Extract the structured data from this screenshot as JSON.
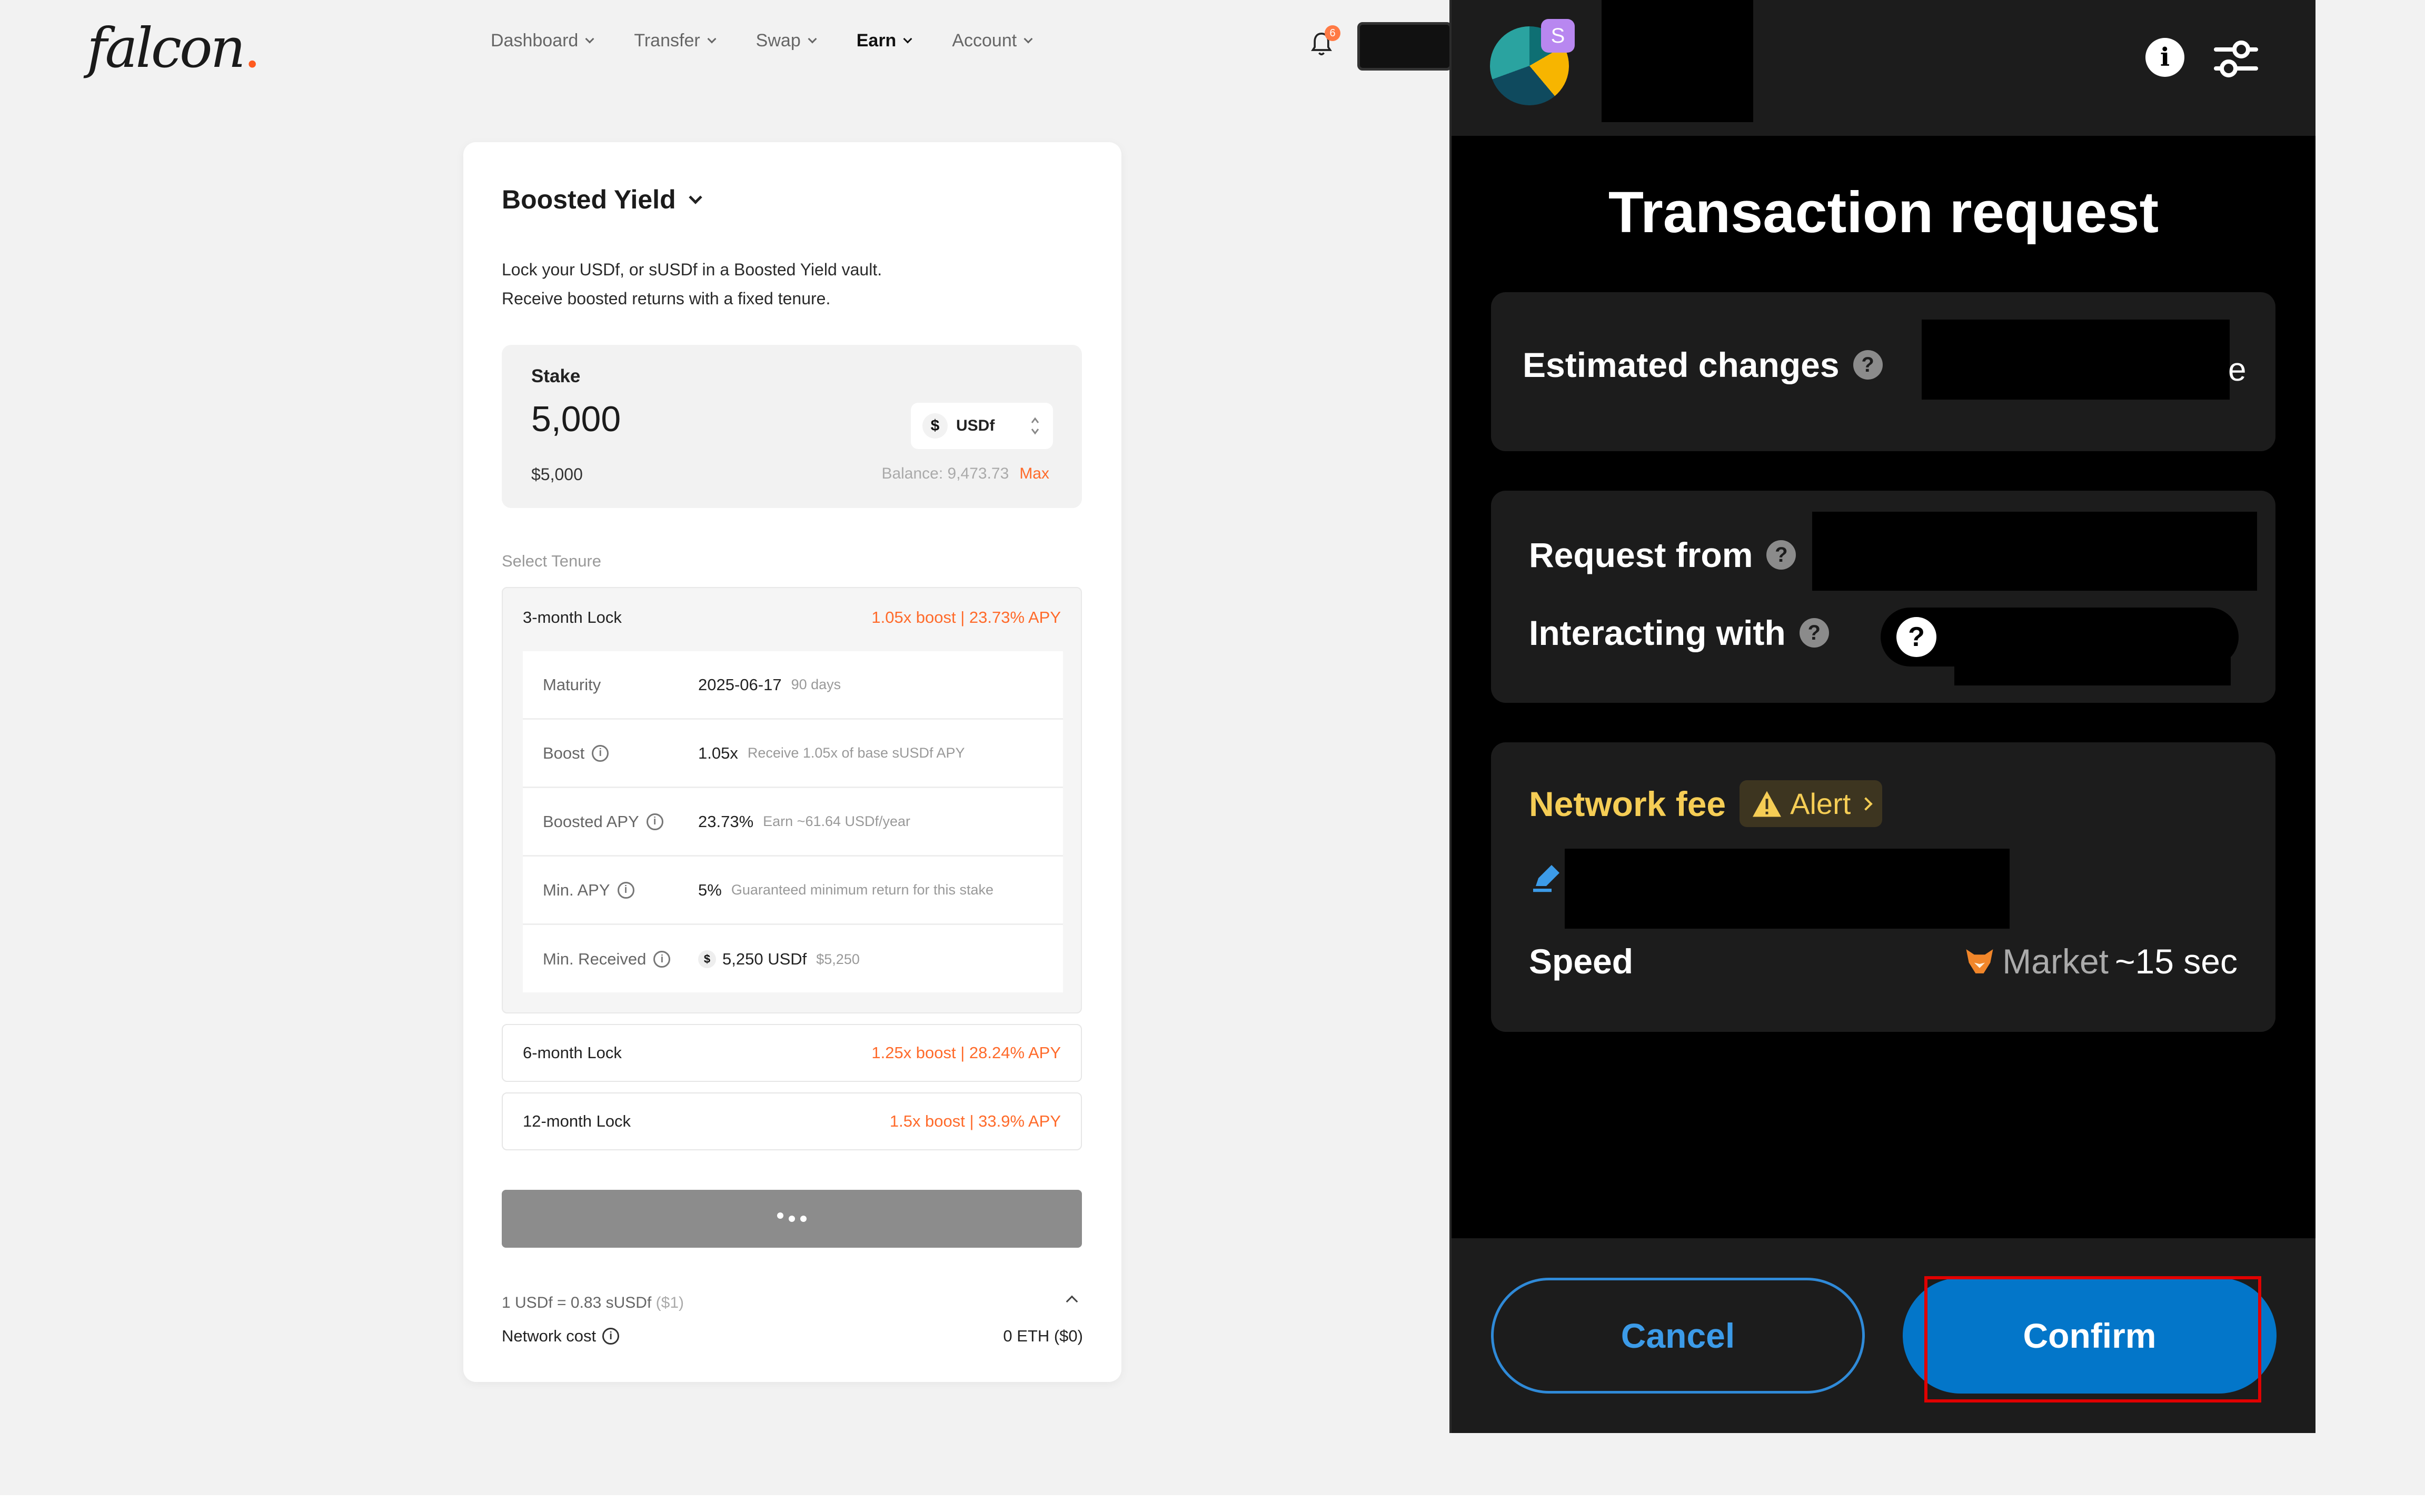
{
  "brand": {
    "name": "falcon",
    "dot": "."
  },
  "nav": {
    "items": [
      {
        "label": "Dashboard"
      },
      {
        "label": "Transfer"
      },
      {
        "label": "Swap"
      },
      {
        "label": "Earn"
      },
      {
        "label": "Account"
      }
    ],
    "active": "Earn",
    "notification_count": "6"
  },
  "stake_card": {
    "title": "Boosted Yield",
    "description_line1": "Lock your USDf, or sUSDf in a Boosted Yield vault.",
    "description_line2": "Receive boosted returns with a fixed tenure.",
    "stake_label": "Stake",
    "amount": "5,000",
    "amount_usd": "$5,000",
    "token": "USDf",
    "token_symbol": "$",
    "balance": "Balance: 9,473.73",
    "max_label": "Max",
    "select_tenure_label": "Select Tenure",
    "tenures": [
      {
        "name": "3-month Lock",
        "boost": "1.05x boost | 23.73% APY"
      },
      {
        "name": "6-month Lock",
        "boost": "1.25x boost | 28.24% APY"
      },
      {
        "name": "12-month Lock",
        "boost": "1.5x boost | 33.9% APY"
      }
    ],
    "details": {
      "maturity": {
        "label": "Maturity",
        "value": "2025-06-17",
        "note": "90 days"
      },
      "boost": {
        "label": "Boost",
        "value": "1.05x",
        "note": "Receive 1.05x of base sUSDf APY"
      },
      "boosted_apy": {
        "label": "Boosted APY",
        "value": "23.73%",
        "note": "Earn ~61.64 USDf/year"
      },
      "min_apy": {
        "label": "Min. APY",
        "value": "5%",
        "note": "Guaranteed minimum return for this stake"
      },
      "min_received": {
        "label": "Min. Received",
        "value": "5,250 USDf",
        "note": "$5,250"
      }
    },
    "rate": "1 USDf = 0.83 sUSDf",
    "rate_usd": "($1)",
    "network_cost_label": "Network cost",
    "network_cost_value": "0 ETH ($0)"
  },
  "wallet": {
    "account_badge": "S",
    "title": "Transaction request",
    "estimated_changes_label": "Estimated changes",
    "estimated_changes_tail": "e",
    "request_from_label": "Request from",
    "interacting_with_label": "Interacting with",
    "network_fee_label": "Network fee",
    "alert_label": "Alert",
    "speed_label": "Speed",
    "speed_value": "Market",
    "speed_time": "~15 sec",
    "cancel_label": "Cancel",
    "confirm_label": "Confirm",
    "colors": {
      "accent": "#0376c9",
      "alert": "#f5cd55",
      "boost": "#ff6a2a",
      "highlight": "#e00000"
    }
  }
}
